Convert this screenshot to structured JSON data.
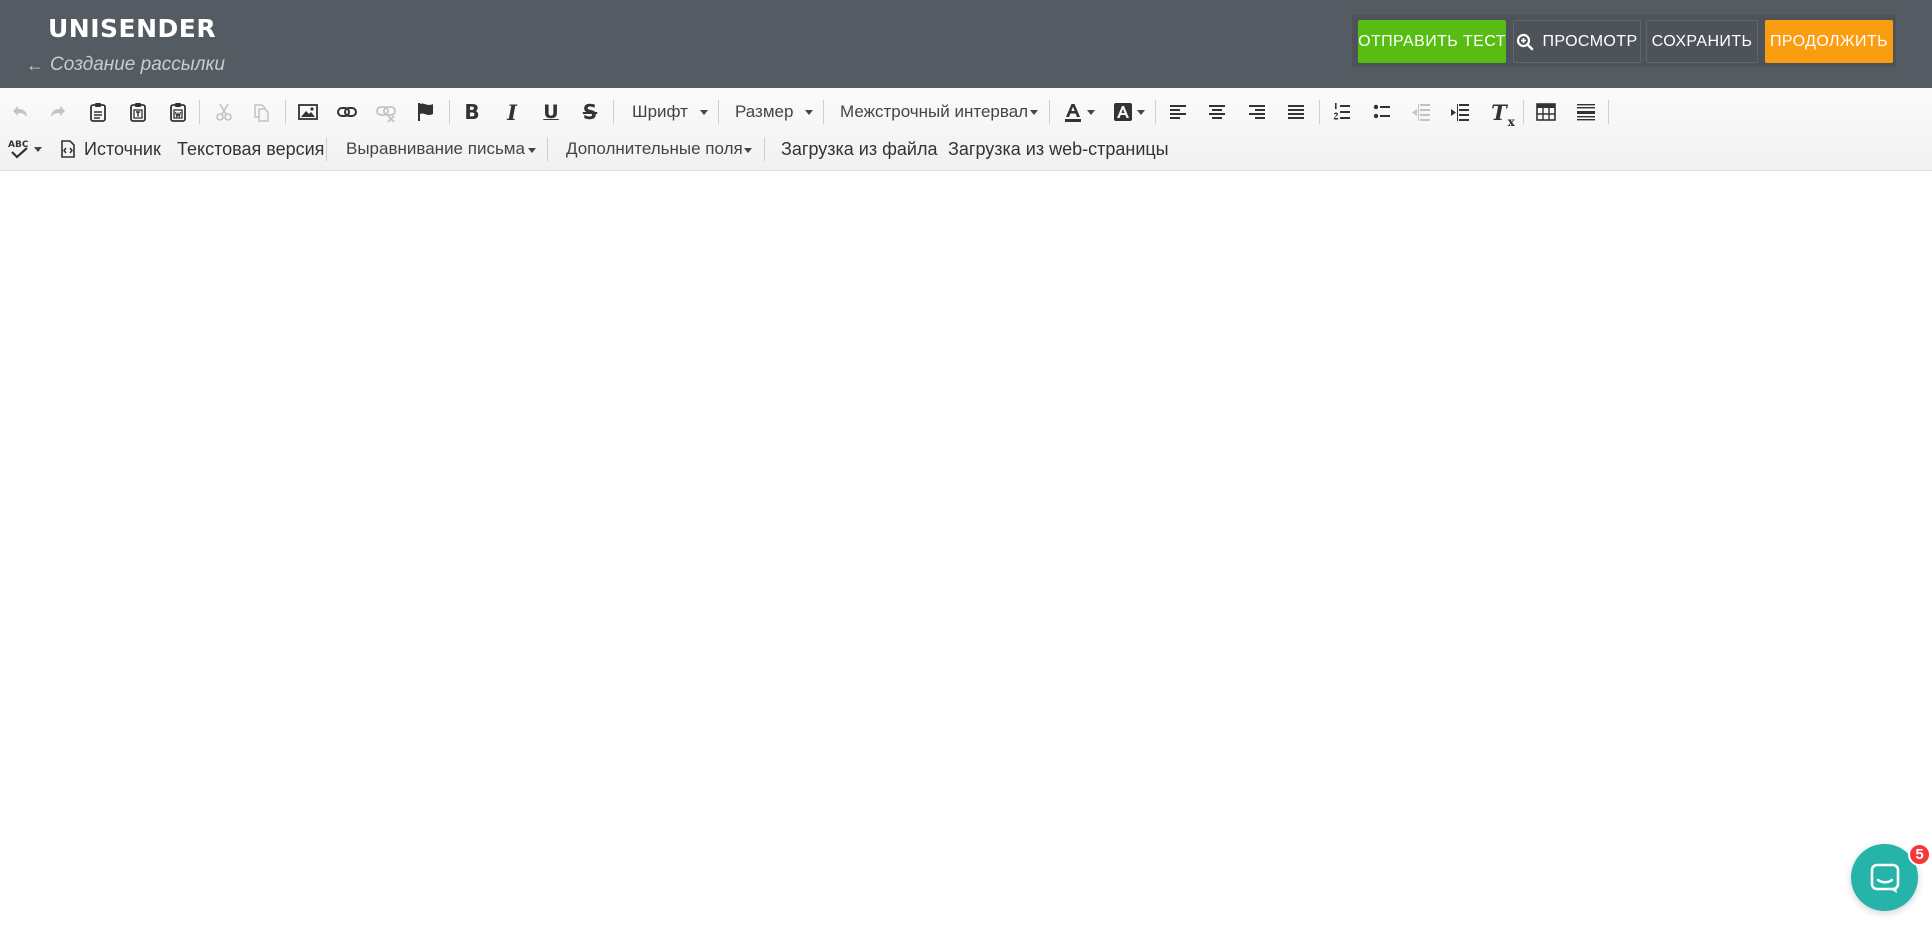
{
  "header": {
    "brand": "UNISENDER",
    "back_arrow": "←",
    "back_label": "Создание рассылки",
    "buttons": {
      "send_test": "ОТПРАВИТЬ ТЕСТ",
      "preview": "ПРОСМОТР",
      "save": "СОХРАНИТЬ",
      "continue": "ПРОДОЛЖИТЬ"
    }
  },
  "toolbar": {
    "bold": "B",
    "italic": "I",
    "underline": "U",
    "strike": "S",
    "remove_format": "T",
    "remove_format_sub": "x",
    "font_combo": "Шрифт",
    "size_combo": "Размер",
    "line_spacing_combo": "Межстрочный интервал",
    "spellcheck_label": "ABC",
    "source": "Источник",
    "text_version": "Текстовая версия",
    "letter_align_combo": "Выравнивание письма",
    "extra_fields_combo": "Дополнительные поля",
    "load_file": "Загрузка из файла",
    "load_web": "Загрузка из web-страницы"
  },
  "chat": {
    "badge_count": "5"
  },
  "colors": {
    "header_bg": "#555b62",
    "send_test": "#58bd13",
    "continue": "#fb9d11",
    "chat": "#25b3aa",
    "badge": "#f5373c"
  },
  "icons": [
    "undo-icon",
    "redo-icon",
    "paste-icon",
    "paste-text-icon",
    "paste-word-icon",
    "cut-icon",
    "copy-icon",
    "image-icon",
    "link-icon",
    "unlink-icon",
    "anchor-flag-icon",
    "text-color-icon",
    "background-color-icon",
    "align-left-icon",
    "align-center-icon",
    "align-right-icon",
    "align-justify-icon",
    "numbered-list-icon",
    "bulleted-list-icon",
    "outdent-icon",
    "indent-icon",
    "table-icon",
    "horizontal-rule-icon",
    "spellcheck-icon",
    "source-icon",
    "preview-search-icon",
    "chat-icon"
  ]
}
